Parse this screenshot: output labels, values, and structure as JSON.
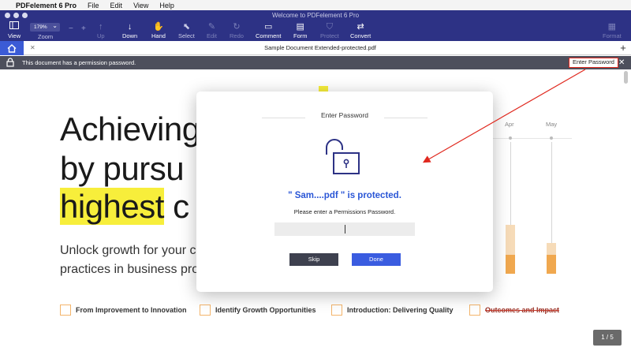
{
  "menubar": {
    "apple": "",
    "app_name": "PDFelement 6 Pro",
    "items": [
      "File",
      "Edit",
      "View",
      "Help"
    ]
  },
  "window": {
    "title": "Welcome to PDFelement 6 Pro"
  },
  "toolbar": {
    "view": "View",
    "zoom_value": "179%",
    "zoom_label": "Zoom",
    "zoom_minus": "−",
    "zoom_plus": "+",
    "up": "Up",
    "down": "Down",
    "hand": "Hand",
    "select": "Select",
    "edit": "Edit",
    "redo": "Redo",
    "comment": "Comment",
    "form": "Form",
    "protect": "Protect",
    "convert": "Convert",
    "format": "Format"
  },
  "tabs": {
    "document_title": "Sample Document Extended-protected.pdf",
    "close": "✕",
    "add": "+"
  },
  "permission_bar": {
    "message": "This document has a permission password.",
    "enter_password": "Enter Password",
    "close": "✕"
  },
  "document": {
    "heading_line1": "Achieving",
    "heading_line2": "by pursu",
    "heading_line3_hl": "highest",
    "heading_line3_rest": " c",
    "sub_line1": "Unlock growth for your co",
    "sub_line2": "practices in business proc",
    "months": [
      "Apr",
      "May"
    ],
    "features": [
      "From Improvement to Innovation",
      "Identify Growth Opportunities",
      "Introduction: Delivering Quality",
      "Outcomes and Impact"
    ],
    "page_indicator": "1 / 5"
  },
  "modal": {
    "title": "Enter Password",
    "protected_text": "\" Sam....pdf \" is protected.",
    "instruction": "Please enter a Permissions Password.",
    "password_value": "",
    "skip": "Skip",
    "done": "Done"
  },
  "colors": {
    "toolbar_bg": "#2d3285",
    "accent_blue": "#3a5ce0",
    "highlight_yellow": "#f7ee3b",
    "annotation_red": "#e0281e",
    "chart_orange": "#f0a84f"
  }
}
